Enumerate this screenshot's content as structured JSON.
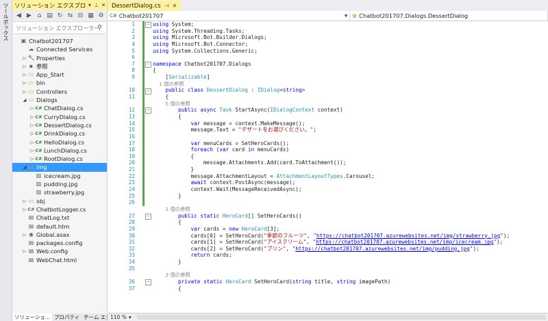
{
  "toolbox": {
    "label": "ツールボックス"
  },
  "solution_explorer": {
    "title": "ソリューション エクスプローラー",
    "search_placeholder": "ソリューション エクスプローラーの検",
    "tree": [
      {
        "label": "Chatbot201707",
        "level": 0,
        "arrow": "",
        "icon": "project-icon",
        "glyph": "▣"
      },
      {
        "label": "Connected Services",
        "level": 1,
        "arrow": "",
        "icon": "connected-services-icon",
        "glyph": "☁"
      },
      {
        "label": "Properties",
        "level": 1,
        "arrow": "▷",
        "icon": "wrench-icon",
        "glyph": "🔧"
      },
      {
        "label": "参照",
        "level": 1,
        "arrow": "▷",
        "icon": "references-icon",
        "glyph": "▪"
      },
      {
        "label": "App_Start",
        "level": 1,
        "arrow": "▷",
        "icon": "folder-icon",
        "glyph": "▭"
      },
      {
        "label": "bin",
        "level": 1,
        "arrow": "▷",
        "icon": "folder-icon",
        "glyph": "▭"
      },
      {
        "label": "Controllers",
        "level": 1,
        "arrow": "▷",
        "icon": "folder-icon",
        "glyph": "▭"
      },
      {
        "label": "Dialogs",
        "level": 1,
        "arrow": "◢",
        "icon": "folder-icon",
        "glyph": "▭"
      },
      {
        "label": "ChatDialog.cs",
        "level": 2,
        "arrow": "▷",
        "icon": "csharp-file-icon",
        "glyph": "C#"
      },
      {
        "label": "CurryDialog.cs",
        "level": 2,
        "arrow": "▷",
        "icon": "csharp-file-icon",
        "glyph": "C#"
      },
      {
        "label": "DessertDialog.cs",
        "level": 2,
        "arrow": "▷",
        "icon": "csharp-file-icon",
        "glyph": "C#"
      },
      {
        "label": "DrinkDialog.cs",
        "level": 2,
        "arrow": "▷",
        "icon": "csharp-file-icon",
        "glyph": "C#"
      },
      {
        "label": "HelloDialog.cs",
        "level": 2,
        "arrow": "▷",
        "icon": "csharp-file-icon",
        "glyph": "C#"
      },
      {
        "label": "LunchDialog.cs",
        "level": 2,
        "arrow": "▷",
        "icon": "csharp-file-icon",
        "glyph": "C#"
      },
      {
        "label": "RootDialog.cs",
        "level": 2,
        "arrow": "▷",
        "icon": "csharp-file-icon",
        "glyph": "C#"
      },
      {
        "label": "img",
        "level": 1,
        "arrow": "◢",
        "icon": "folder-icon",
        "glyph": "▭",
        "selected": true
      },
      {
        "label": "icecream.jpg",
        "level": 2,
        "arrow": "",
        "icon": "image-file-icon",
        "glyph": "▨"
      },
      {
        "label": "pudding.jpg",
        "level": 2,
        "arrow": "",
        "icon": "image-file-icon",
        "glyph": "▨"
      },
      {
        "label": "strawberry.jpg",
        "level": 2,
        "arrow": "",
        "icon": "image-file-icon",
        "glyph": "▨"
      },
      {
        "label": "obj",
        "level": 1,
        "arrow": "▷",
        "icon": "folder-icon",
        "glyph": "▭"
      },
      {
        "label": "ChatbotLogger.cs",
        "level": 1,
        "arrow": "▷",
        "icon": "csharp-file-icon",
        "glyph": "C#"
      },
      {
        "label": "ChatLog.txt",
        "level": 1,
        "arrow": "",
        "icon": "text-file-icon",
        "glyph": "▤"
      },
      {
        "label": "default.htm",
        "level": 1,
        "arrow": "",
        "icon": "html-file-icon",
        "glyph": "▤"
      },
      {
        "label": "Global.asax",
        "level": 1,
        "arrow": "▷",
        "icon": "global-file-icon",
        "glyph": "◉"
      },
      {
        "label": "packages.config",
        "level": 1,
        "arrow": "",
        "icon": "config-file-icon",
        "glyph": "▤"
      },
      {
        "label": "Web.config",
        "level": 1,
        "arrow": "▷",
        "icon": "config-file-icon",
        "glyph": "▤"
      },
      {
        "label": "WebChat.html",
        "level": 1,
        "arrow": "",
        "icon": "html-file-icon",
        "glyph": "▤"
      }
    ],
    "bottom_tabs": [
      "ソリューショ...",
      "プロパティ",
      "チーム エク..."
    ]
  },
  "editor": {
    "tab_label": "DessertDialog.cs",
    "nav_project": "Chatbot201707",
    "nav_class": "Chatbot201707.Dialogs.DessertDialog",
    "zoom": "110 %",
    "line_numbers": [
      "1",
      "2",
      "3",
      "4",
      "5",
      "6",
      "7",
      "8",
      "9",
      "",
      "10",
      "11",
      "",
      "12",
      "13",
      "14",
      "15",
      "16",
      "17",
      "18",
      "19",
      "20",
      "21",
      "22",
      "23",
      "24",
      "25",
      "26",
      "",
      "27",
      "28",
      "29",
      "30",
      "31",
      "32",
      "33",
      "34",
      "35",
      "",
      "36",
      "37"
    ],
    "lines": [
      "using System;",
      "using System.Threading.Tasks;",
      "using Microsoft.Bot.Builder.Dialogs;",
      "using Microsoft.Bot.Connector;",
      "using System.Collections.Generic;",
      "",
      "namespace Chatbot201707.Dialogs",
      "{",
      "    [Serializable]",
      "    1 個の参照",
      "    public class DessertDialog : IDialog<string>",
      "    {",
      "        5 個の参照",
      "        public async Task StartAsync(IDialogContext context)",
      "        {",
      "            var message = context.MakeMessage();",
      "            message.Text = \"デザートをお選びください。\";",
      "",
      "            var menuCards = SetHeroCards();",
      "            foreach (var card in menuCards)",
      "            {",
      "                message.Attachments.Add(card.ToAttachment());",
      "            }",
      "            message.AttachmentLayout = AttachmentLayoutTypes.Carousel;",
      "            await context.PostAsync(message);",
      "            context.Wait(MessageReceivedAsync);",
      "        }",
      "",
      "        1 個の参照",
      "        public static HeroCard[] SetHeroCards()",
      "        {",
      "            var cards = new HeroCard[3];",
      "            cards[0] = SetHeroCard(\"季節のフルーツ\", \"https://chatbot201707.azurewebsites.net/img/strawberry.jpg\");",
      "            cards[1] = SetHeroCard(\"アイスクリーム\", \"https://chatbot201707.azurewebsites.net/img/icecream.jpg\");",
      "            cards[2] = SetHeroCard(\"プリン\", \"https://chatbot201707.azurewebsites.net/img/pudding.jpg\");",
      "            return cards;",
      "        }",
      "",
      "        3 個の参照",
      "        private static HeroCard SetHeroCard(string title, string imagePath)",
      "        {"
    ]
  }
}
